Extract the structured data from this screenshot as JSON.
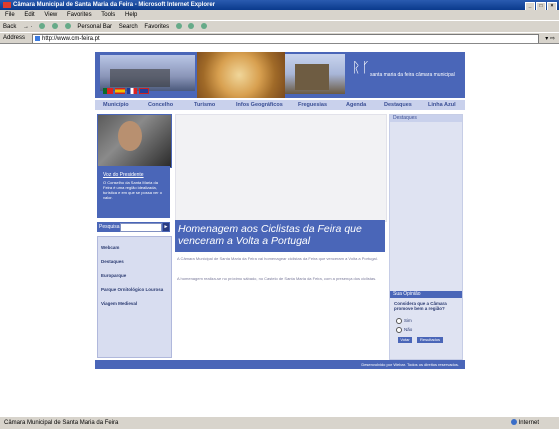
{
  "window": {
    "title": "Câmara Municipal de Santa Maria da Feira - Microsoft Internet Explorer"
  },
  "menu": [
    "File",
    "Edit",
    "View",
    "Favorites",
    "Tools",
    "Help"
  ],
  "toolbar": {
    "back": "Back",
    "personal_bar": "Personal Bar",
    "search": "Search",
    "favorites": "Favorites"
  },
  "address": {
    "label": "Address",
    "url": "http://www.cm-feira.pt"
  },
  "site": {
    "logo_text": "santa maria da feira câmara municipal",
    "nav": [
      "Município",
      "Concelho",
      "Turismo",
      "Infos Geográficos",
      "Freguesias",
      "Agenda",
      "Destaques",
      "Linha Azul"
    ],
    "mayor": {
      "title": "Voz do Presidente",
      "text": "O Conselho da Santa Maria da Feira é uma região idealizada, turística e em que se possa ver o valor."
    },
    "search_label": "Pesquisa",
    "search_go": "►",
    "side_links": [
      "Webcam",
      "Destaques",
      "Europarque",
      "Parque Ornitológico Lourosa",
      "Viagem Medieval"
    ],
    "headline": "Homenagem aos Ciclistas da Feira que venceram a Volta a Portugal",
    "news_text_1": "A Câmara Municipal de Santa Maria da Feira vai homenagear ciclistas da Feira que venceram a Volta a Portugal.",
    "news_text_2": "A homenagem realiza-se no próximo sábado, no Castelo de Santa Maria da Feira, com a presença dos ciclistas.",
    "right_header": "Destaques",
    "poll": {
      "header": "Sua Opinião",
      "question": "Considera que a Câmara promove bem a região?",
      "options": [
        "Sim",
        "Não"
      ],
      "vote": "Votar",
      "results": "Resultados"
    },
    "footer": "Desenvolvido por Webar. Todos os direitos reservados."
  },
  "status": {
    "text": "Câmara Municipal de Santa Maria da Feira",
    "zone": "Internet"
  },
  "colors": {
    "accent": "#4a66b8",
    "nav_bg": "#c9d1ec"
  }
}
